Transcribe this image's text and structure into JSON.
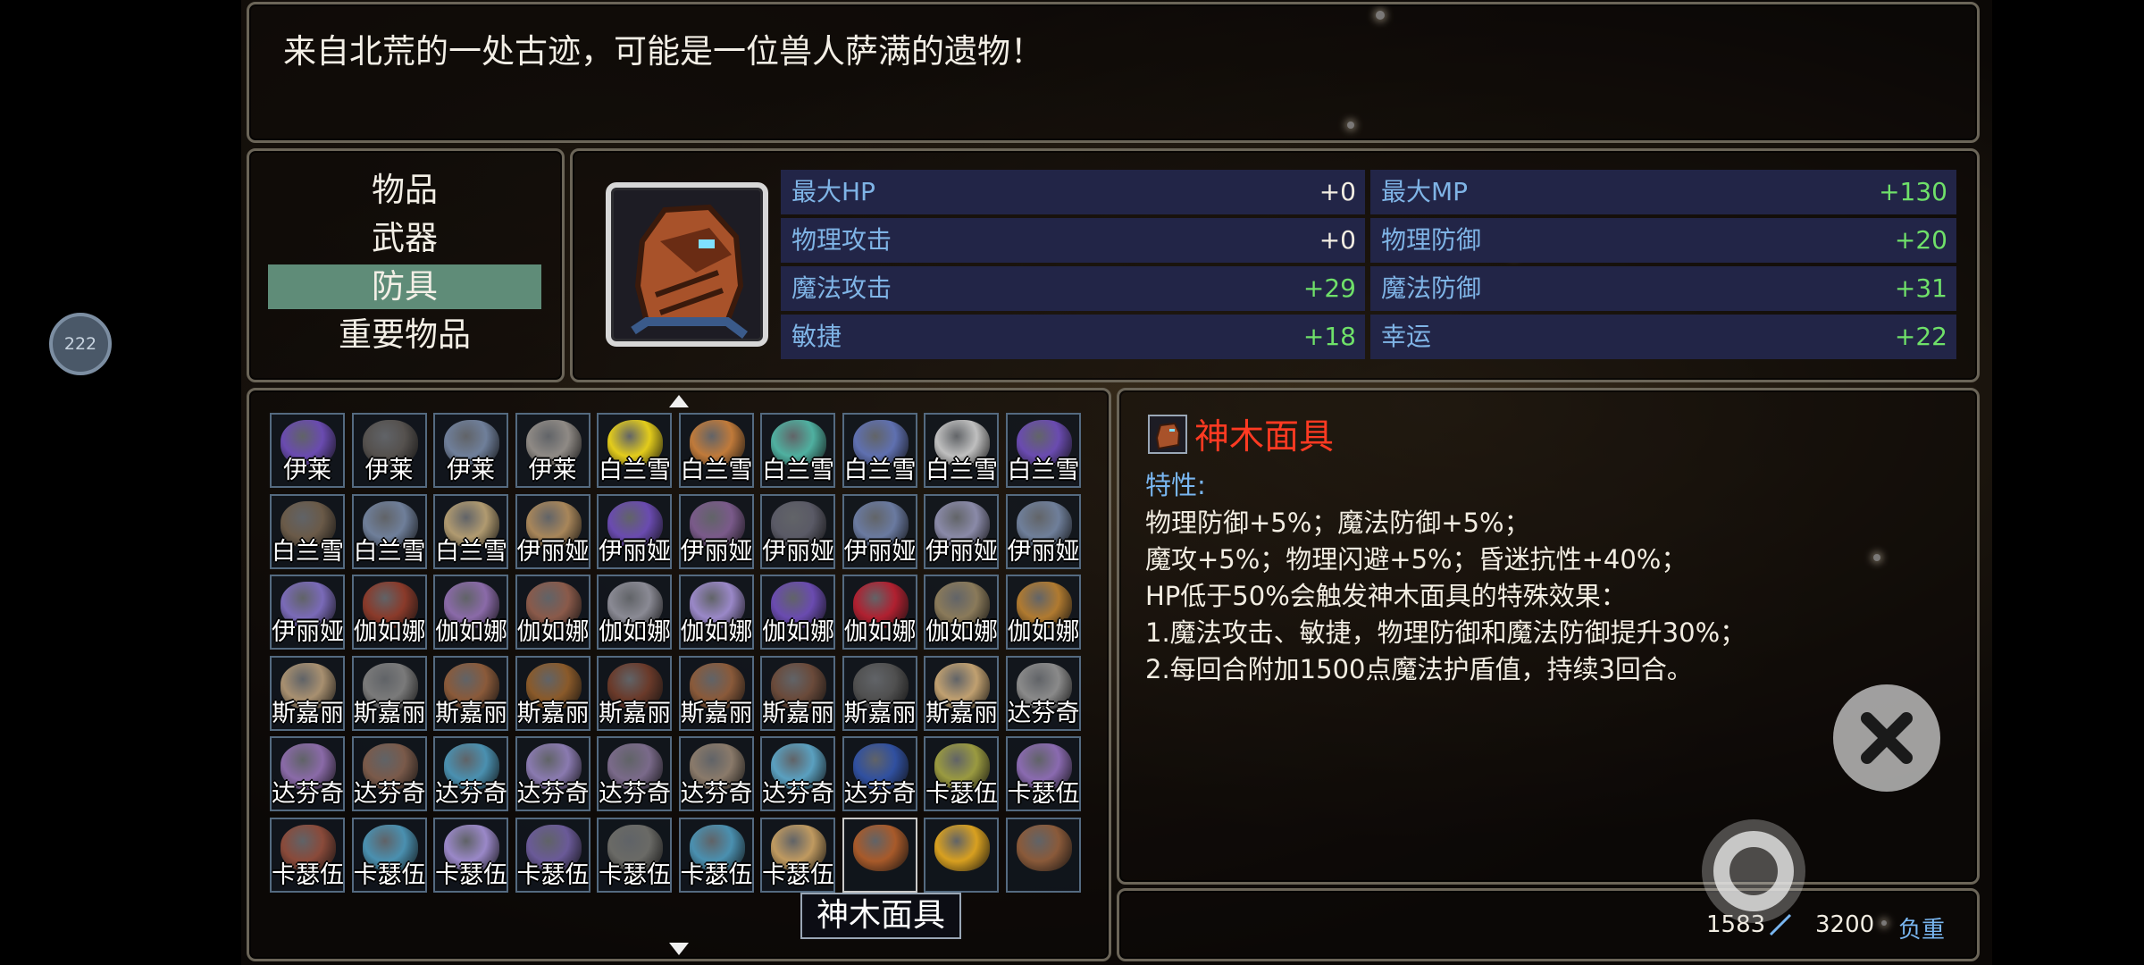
{
  "description": "来自北荒的一处古迹，可能是一位兽人萨满的遗物！",
  "badge": "222",
  "categories": [
    {
      "label": "物品"
    },
    {
      "label": "武器"
    },
    {
      "label": "防具"
    },
    {
      "label": "重要物品"
    }
  ],
  "selected_category": 2,
  "stats": [
    {
      "name": "最大HP",
      "value": "+0"
    },
    {
      "name": "最大MP",
      "value": "+130"
    },
    {
      "name": "物理攻击",
      "value": "+0"
    },
    {
      "name": "物理防御",
      "value": "+20"
    },
    {
      "name": "魔法攻击",
      "value": "+29"
    },
    {
      "name": "魔法防御",
      "value": "+31"
    },
    {
      "name": "敏捷",
      "value": "+18"
    },
    {
      "name": "幸运",
      "value": "+22"
    }
  ],
  "grid": [
    [
      "伊莱",
      "伊莱",
      "伊莱",
      "伊莱",
      "白兰雪",
      "白兰雪",
      "白兰雪",
      "白兰雪",
      "白兰雪",
      "白兰雪"
    ],
    [
      "白兰雪",
      "白兰雪",
      "白兰雪",
      "伊丽娅",
      "伊丽娅",
      "伊丽娅",
      "伊丽娅",
      "伊丽娅",
      "伊丽娅",
      "伊丽娅"
    ],
    [
      "伊丽娅",
      "伽如娜",
      "伽如娜",
      "伽如娜",
      "伽如娜",
      "伽如娜",
      "伽如娜",
      "伽如娜",
      "伽如娜",
      "伽如娜"
    ],
    [
      "斯嘉丽",
      "斯嘉丽",
      "斯嘉丽",
      "斯嘉丽",
      "斯嘉丽",
      "斯嘉丽",
      "斯嘉丽",
      "斯嘉丽",
      "斯嘉丽",
      "达芬奇"
    ],
    [
      "达芬奇",
      "达芬奇",
      "达芬奇",
      "达芬奇",
      "达芬奇",
      "达芬奇",
      "达芬奇",
      "达芬奇",
      "卡瑟伍德",
      "卡瑟伍德"
    ],
    [
      "卡瑟伍德",
      "卡瑟伍德",
      "卡瑟伍德",
      "卡瑟伍德",
      "卡瑟伍德",
      "卡瑟伍德",
      "卡瑟伍德",
      "",
      "",
      ""
    ]
  ],
  "icon_colors": [
    [
      "#6a4bb0",
      "#55514e",
      "#6f7f9a",
      "#8f8a85",
      "#e3cc1b",
      "#c07a3a",
      "#4fb0a0",
      "#5f70b0",
      "#bfbfbf",
      "#6a4bb0"
    ],
    [
      "#6a5a48",
      "#6f7f9a",
      "#b09a70",
      "#a8865a",
      "#6a4bb0",
      "#7a5a8a",
      "#5a5a66",
      "#6a7aa0",
      "#8a8aa8",
      "#6f7f9a"
    ],
    [
      "#7a6ab8",
      "#8a3a2a",
      "#8a6aa8",
      "#8a5a4a",
      "#8a8a94",
      "#9a88c8",
      "#6a4bb0",
      "#b02030",
      "#8a7a5a",
      "#b07a30"
    ],
    [
      "#a89070",
      "#7a7a7a",
      "#8a5a3a",
      "#8a5a2a",
      "#6a3a2a",
      "#8a5a3a",
      "#6a4a3a",
      "#505050",
      "#c0a070",
      "#8a8a8a"
    ],
    [
      "#8a6aa8",
      "#7a5a4a",
      "#4a90b0",
      "#8a7ab0",
      "#7a6a8a",
      "#8a7a6a",
      "#5aa0c0",
      "#3050a0",
      "#9a9a40",
      "#8a6ab0"
    ],
    [
      "#8a4a3a",
      "#4a90b0",
      "#9a88c8",
      "#6a5a98",
      "#6a6a66",
      "#4a90b0",
      "#c09a60",
      "#a85a2a",
      "#d8a020",
      "#8a5a3a"
    ]
  ],
  "tooltip": "神木面具",
  "item": {
    "name": "神木面具",
    "trait_label": "特性:",
    "lines": [
      "物理防御+5%；魔法防御+5%；",
      "魔攻+5%；物理闪避+5%；昏迷抗性+40%；",
      "HP低于50%会触发神木面具的特殊效果：",
      "1.魔法攻击、敏捷，物理防御和魔法防御提升30%；",
      "2.每回合附加1500点魔法护盾值，持续3回合。"
    ]
  },
  "weight": {
    "current": "1583",
    "max": "3200",
    "label": "负重"
  },
  "selected_slot": [
    5,
    7
  ],
  "current_slot": [
    0,
    4
  ]
}
